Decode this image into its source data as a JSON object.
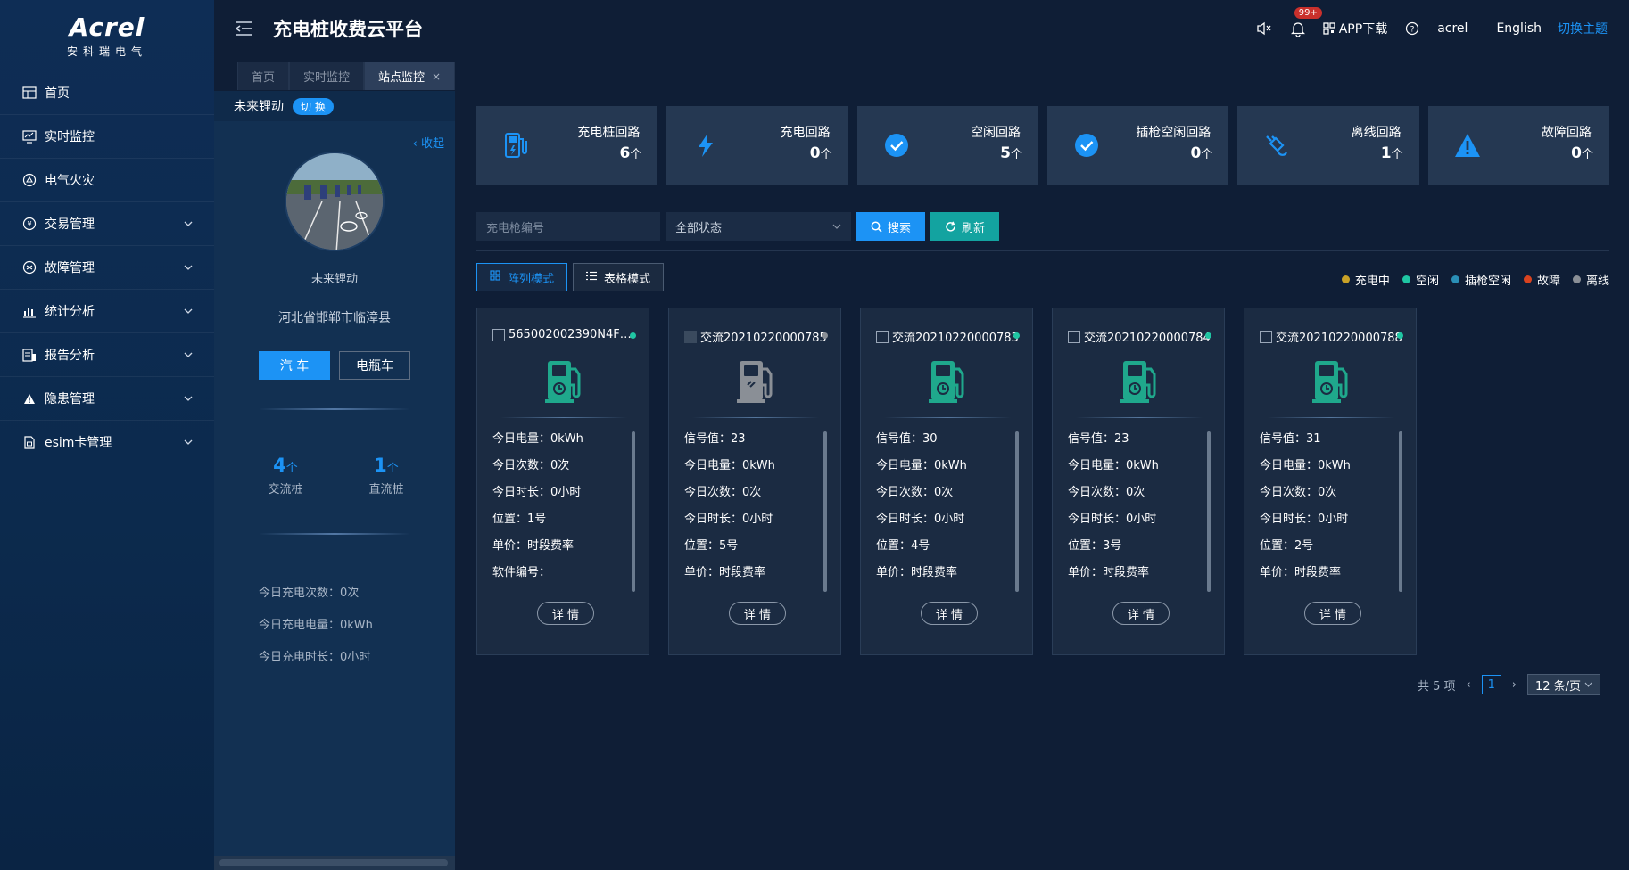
{
  "logo": {
    "brand": "Acrel",
    "subtitle": "安科瑞电气"
  },
  "sidebar": {
    "items": [
      {
        "label": "首页",
        "icon": "dashboard-icon",
        "has_children": false
      },
      {
        "label": "实时监控",
        "icon": "monitor-icon",
        "has_children": false
      },
      {
        "label": "电气火灾",
        "icon": "fire-icon",
        "has_children": false
      },
      {
        "label": "交易管理",
        "icon": "transaction-icon",
        "has_children": true
      },
      {
        "label": "故障管理",
        "icon": "fault-icon",
        "has_children": true
      },
      {
        "label": "统计分析",
        "icon": "bar-chart-icon",
        "has_children": true
      },
      {
        "label": "报告分析",
        "icon": "report-icon",
        "has_children": true
      },
      {
        "label": "隐患管理",
        "icon": "warning-icon",
        "has_children": true
      },
      {
        "label": "esim卡管理",
        "icon": "sim-card-icon",
        "has_children": true
      }
    ]
  },
  "header": {
    "title": "充电桩收费云平台",
    "notification_badge": "99+",
    "app_download": "APP下载",
    "user": "acrel",
    "language": "English",
    "theme_switch": "切换主题"
  },
  "tabs": [
    {
      "label": "首页",
      "active": false,
      "closable": false
    },
    {
      "label": "实时监控",
      "active": false,
      "closable": false
    },
    {
      "label": "站点监控",
      "active": true,
      "closable": true
    }
  ],
  "station": {
    "header_name": "未来锂动",
    "switch_label": "切 换",
    "collapse_label": "收起",
    "name": "未来锂动",
    "address": "河北省邯郸市临漳县",
    "vehicle_tabs": [
      {
        "label": "汽 车",
        "active": true
      },
      {
        "label": "电瓶车",
        "active": false
      }
    ],
    "ac_count": "4",
    "dc_count": "1",
    "count_unit": "个",
    "ac_label": "交流桩",
    "dc_label": "直流桩",
    "today_charge_times": "今日充电次数：0次",
    "today_charge_energy": "今日充电电量：0kWh",
    "today_charge_duration": "今日充电时长：0小时"
  },
  "stats": [
    {
      "label": "充电桩回路",
      "value": "6",
      "unit": "个",
      "icon": "charging-pile-icon"
    },
    {
      "label": "充电回路",
      "value": "0",
      "unit": "个",
      "icon": "lightning-icon"
    },
    {
      "label": "空闲回路",
      "value": "5",
      "unit": "个",
      "icon": "check-circle-icon"
    },
    {
      "label": "插枪空闲回路",
      "value": "0",
      "unit": "个",
      "icon": "check-circle-icon"
    },
    {
      "label": "离线回路",
      "value": "1",
      "unit": "个",
      "icon": "unplug-icon"
    },
    {
      "label": "故障回路",
      "value": "0",
      "unit": "个",
      "icon": "alert-triangle-icon"
    }
  ],
  "filters": {
    "gun_placeholder": "充电枪编号",
    "status_value": "全部状态",
    "search_label": "搜索",
    "refresh_label": "刷新"
  },
  "modes": [
    {
      "label": "阵列模式",
      "active": true
    },
    {
      "label": "表格模式",
      "active": false
    }
  ],
  "legend": [
    {
      "label": "充电中",
      "color": "#c9a227"
    },
    {
      "label": "空闲",
      "color": "#1fc6a3"
    },
    {
      "label": "插枪空闲",
      "color": "#2a8fb6"
    },
    {
      "label": "故障",
      "color": "#d9431f"
    },
    {
      "label": "离线",
      "color": "#8a8f96"
    }
  ],
  "cards": [
    {
      "title": "565002002390N4F0...",
      "status_color": "#1fc6a3",
      "offline": false,
      "info": [
        "今日电量：0kWh",
        "今日次数：0次",
        "今日时长：0小时",
        "位置：1号",
        "单价：时段费率",
        "软件编号："
      ]
    },
    {
      "title": "交流20210220000785",
      "status_color": "#8a8f96",
      "offline": true,
      "info": [
        "信号值：23",
        "今日电量：0kWh",
        "今日次数：0次",
        "今日时长：0小时",
        "位置：5号",
        "单价：时段费率"
      ]
    },
    {
      "title": "交流20210220000783",
      "status_color": "#1fc6a3",
      "offline": false,
      "info": [
        "信号值：30",
        "今日电量：0kWh",
        "今日次数：0次",
        "今日时长：0小时",
        "位置：4号",
        "单价：时段费率"
      ]
    },
    {
      "title": "交流20210220000784",
      "status_color": "#1fc6a3",
      "offline": false,
      "info": [
        "信号值：23",
        "今日电量：0kWh",
        "今日次数：0次",
        "今日时长：0小时",
        "位置：3号",
        "单价：时段费率"
      ]
    },
    {
      "title": "交流20210220000788",
      "status_color": "#1fc6a3",
      "offline": false,
      "info": [
        "信号值：31",
        "今日电量：0kWh",
        "今日次数：0次",
        "今日时长：0小时",
        "位置：2号",
        "单价：时段费率"
      ]
    }
  ],
  "card_detail_label": "详 情",
  "pagination": {
    "total": "共 5 项",
    "current": "1",
    "page_size": "12 条/页"
  }
}
